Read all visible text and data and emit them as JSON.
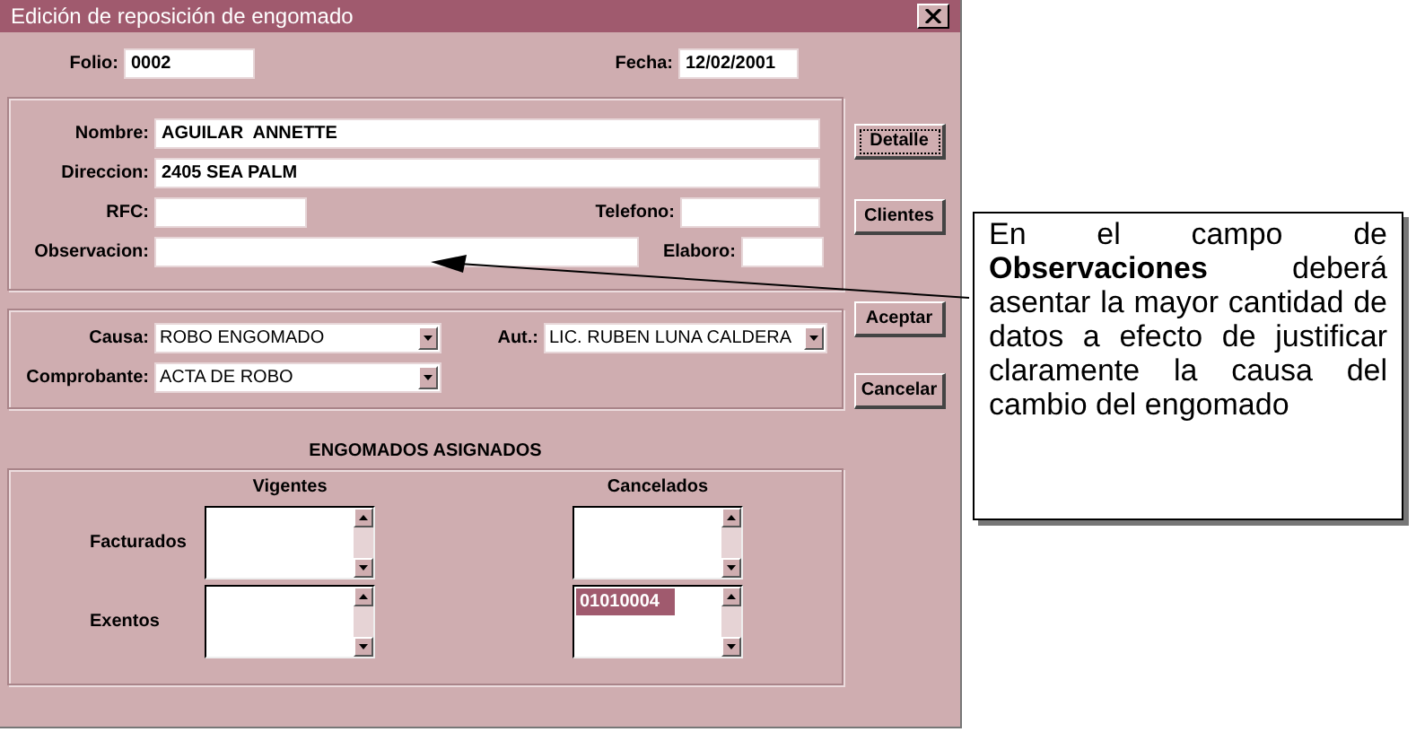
{
  "window": {
    "title": "Edición de reposición de engomado"
  },
  "folio": {
    "label": "Folio:",
    "value": "0002"
  },
  "fecha": {
    "label": "Fecha:",
    "value": "12/02/2001"
  },
  "cliente": {
    "nombre": {
      "label": "Nombre:",
      "value": "AGUILAR  ANNETTE"
    },
    "direccion": {
      "label": "Direccion:",
      "value": "2405 SEA PALM"
    },
    "rfc": {
      "label": "RFC:"
    },
    "telefono": {
      "label": "Telefono:"
    },
    "observacion": {
      "label": "Observacion:"
    },
    "elaboro": {
      "label": "Elaboro:"
    }
  },
  "buttons": [
    {
      "label": "Detalle",
      "focused": true
    },
    {
      "label": "Clientes",
      "focused": false
    },
    {
      "label": "Aceptar",
      "focused": false
    },
    {
      "label": "Cancelar",
      "focused": false
    }
  ],
  "causa": {
    "label": "Causa:",
    "value": "ROBO ENGOMADO"
  },
  "aut": {
    "label": "Aut.:",
    "value": "LIC. RUBEN LUNA CALDERA"
  },
  "comprobante": {
    "label": "Comprobante:",
    "value": "ACTA DE ROBO"
  },
  "engomados": {
    "title": "ENGOMADOS ASIGNADOS",
    "columns": [
      "Vigentes",
      "Cancelados"
    ],
    "rows": [
      {
        "label": "Facturados",
        "lists": [
          {
            "kind": "listbox"
          },
          {
            "kind": "listbox"
          }
        ]
      },
      {
        "label": "Exentos",
        "lists": [
          {
            "kind": "listbox"
          },
          {
            "kind": "listbox",
            "items": [
              {
                "text": "01010004",
                "selected": true
              }
            ]
          }
        ]
      }
    ]
  },
  "callout": {
    "text": "En el campo de **Observaciones** deberá asentar la mayor cantidad de datos a efecto de justificar claramente la causa del cambio del engomado"
  }
}
